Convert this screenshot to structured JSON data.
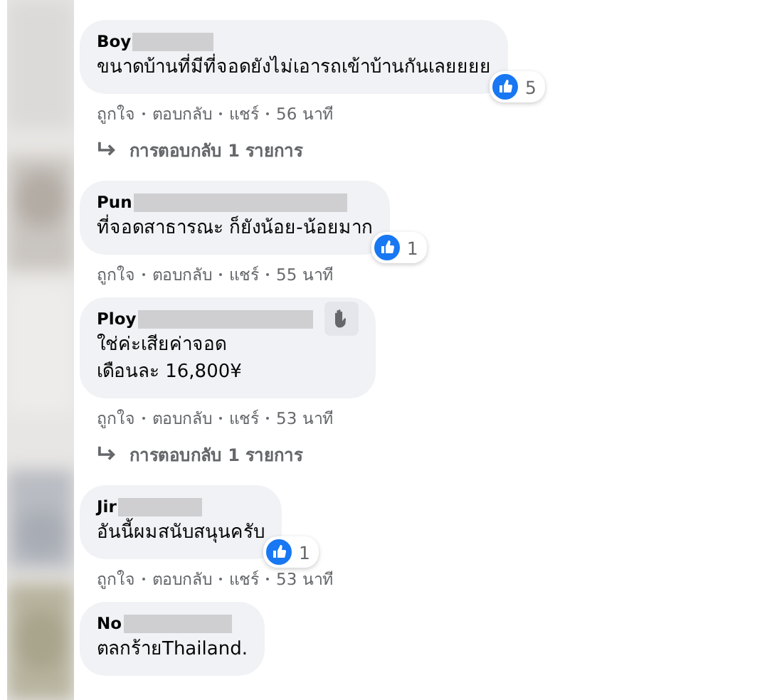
{
  "comments": [
    {
      "name": "Boy",
      "redacted": true,
      "badge": false,
      "lines": [
        "ขนาดบ้านที่มีที่จอดยังไม่เอารถเข้าบ้านกันเลยยยย"
      ],
      "likes": "5",
      "actions": [
        "ถูกใจ",
        "ตอบกลับ",
        "แชร์"
      ],
      "time": "56 นาที",
      "replies": "การตอบกลับ 1 รายการ"
    },
    {
      "name": "Pun",
      "redacted": true,
      "badge": false,
      "lines": [
        "ที่จอดสาธารณะ ก็ยังน้อย-น้อยมาก"
      ],
      "likes": "1",
      "actions": [
        "ถูกใจ",
        "ตอบกลับ",
        "แชร์"
      ],
      "time": "55 นาที"
    },
    {
      "name": "Ploy",
      "redacted": true,
      "badge": true,
      "lines": [
        "ใช่ค่ะเสียค่าจอด",
        "เดือนละ 16,800¥"
      ],
      "actions": [
        "ถูกใจ",
        "ตอบกลับ",
        "แชร์"
      ],
      "time": "53 นาที",
      "replies": "การตอบกลับ 1 รายการ"
    },
    {
      "name": "Jir",
      "redacted": true,
      "badge": false,
      "lines": [
        "อันนี้ผมสนับสนุนครับ"
      ],
      "likes": "1",
      "actions": [
        "ถูกใจ",
        "ตอบกลับ",
        "แชร์"
      ],
      "time": "53 นาที"
    },
    {
      "name": "No",
      "redacted": true,
      "badge": false,
      "lines": [
        "ตลกร้ายThailand."
      ]
    }
  ]
}
